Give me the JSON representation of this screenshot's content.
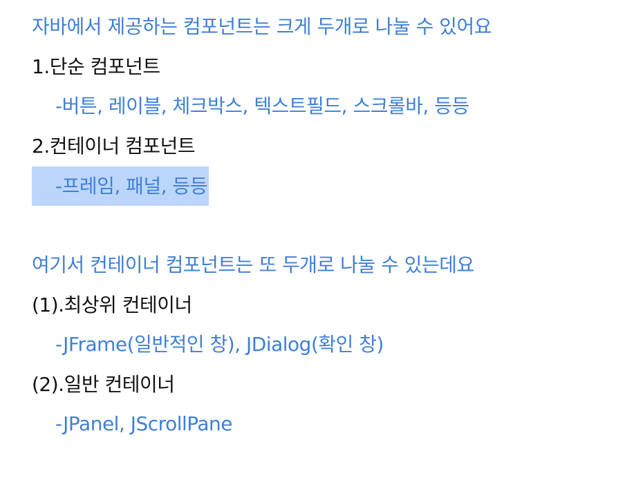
{
  "colors": {
    "accent_blue": "#3f7fd6",
    "text_black": "#111111",
    "selection": "#bcd6fb"
  },
  "lines": {
    "intro": "자바에서 제공하는 컴포넌트는 크게 두개로 나눌 수 있어요",
    "simple_heading": "1.단순 컴포넌트",
    "simple_items": "-버튼, 레이블, 체크박스, 텍스트필드, 스크롤바, 등등",
    "container_heading": "2.컨테이너 컴포넌트",
    "container_items": "-프레임, 패널, 등등",
    "container_intro": "여기서 컨테이너 컴포넌트는 또 두개로 나눌 수 있는데요",
    "top_level_heading": "(1).최상위 컨테이너",
    "top_level_items": "-JFrame(일반적인 창), JDialog(확인 창)",
    "general_heading": "(2).일반 컨테이너",
    "general_items": "-JPanel, JScrollPane"
  }
}
